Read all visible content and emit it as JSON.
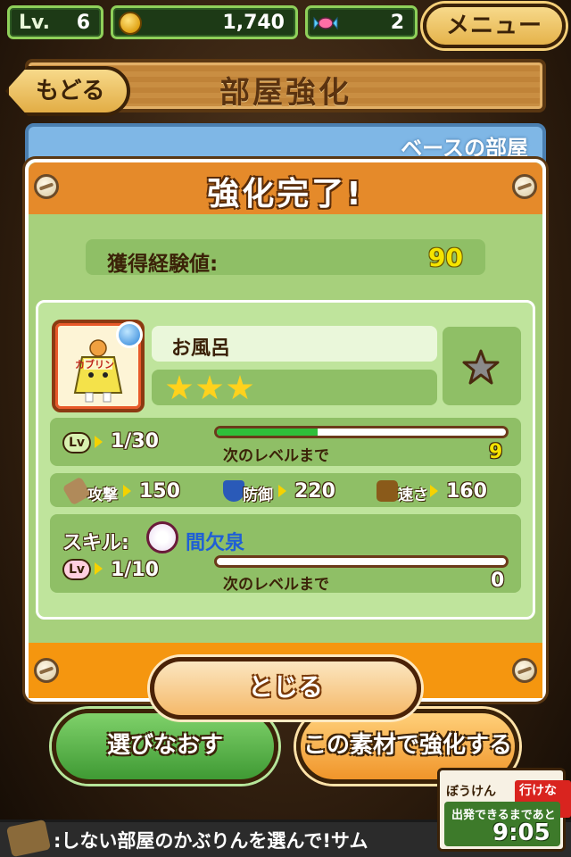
{
  "status_bar": {
    "level_label": "Lv.",
    "level_value": "6",
    "coins": "1,740",
    "candy": "2",
    "menu_label": "メニュー"
  },
  "header": {
    "back_label": "もどる",
    "title": "部屋強化",
    "room_label": "ベースの部屋"
  },
  "dialog": {
    "title": "強化完了!",
    "exp_label": "獲得経験値:",
    "exp_value": "90",
    "close_label": "とじる"
  },
  "character": {
    "card_label": "カブリン",
    "name": "お風呂",
    "rarity_stars": 3,
    "element_icon": "water-drop-icon",
    "level_badge": "Lv",
    "level": "1/30",
    "level_progress": 0.35,
    "next_level_label": "次のレベルまで",
    "next_level_value": "9",
    "attack_label": "攻撃",
    "attack_value": "150",
    "defense_label": "防御",
    "defense_value": "220",
    "speed_label": "速さ",
    "speed_value": "160",
    "skill_label": "スキル:",
    "skill_name": "間欠泉",
    "skill_level": "1/10",
    "skill_progress": 0.0,
    "skill_next_label": "次のレベルまで",
    "skill_next_value": "0"
  },
  "footer_buttons": {
    "reselect_label": "選びなおす",
    "enhance_label": "この素材で強化する"
  },
  "ticker": {
    "text": ":しない部屋のかぶりんを選んで!サム"
  },
  "timer": {
    "top_label": "ぼうけん",
    "status_tag": "行けない",
    "label": "出発できるまであと",
    "value": "9:05"
  },
  "colors": {
    "panel_green": "#a7d07c",
    "header_orange": "#e58a2a",
    "exp_yellow": "#f5e400",
    "skill_blue": "#1f5fd6"
  }
}
